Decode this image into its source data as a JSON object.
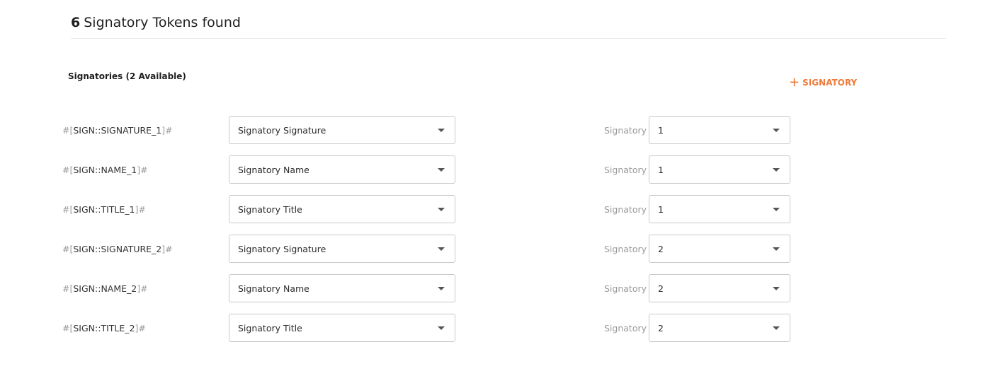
{
  "header": {
    "count": "6",
    "title": "Signatory Tokens found"
  },
  "section": {
    "label": "Signatories (2 Available)"
  },
  "add_button": {
    "icon": "plus-icon",
    "plus": "+",
    "label": "SIGNATORY"
  },
  "colors": {
    "accent": "#f07a3a",
    "muted": "#9a9a9a",
    "border": "#c9c9c9"
  },
  "token_prefix": "#[",
  "token_suffix": "]#",
  "signatory_label": "Signatory",
  "rows": [
    {
      "token": "SIGN::SIGNATURE_1",
      "type": "Signatory Signature",
      "signatory": "1"
    },
    {
      "token": "SIGN::NAME_1",
      "type": "Signatory Name",
      "signatory": "1"
    },
    {
      "token": "SIGN::TITLE_1",
      "type": "Signatory Title",
      "signatory": "1"
    },
    {
      "token": "SIGN::SIGNATURE_2",
      "type": "Signatory Signature",
      "signatory": "2"
    },
    {
      "token": "SIGN::NAME_2",
      "type": "Signatory Name",
      "signatory": "2"
    },
    {
      "token": "SIGN::TITLE_2",
      "type": "Signatory Title",
      "signatory": "2"
    }
  ]
}
